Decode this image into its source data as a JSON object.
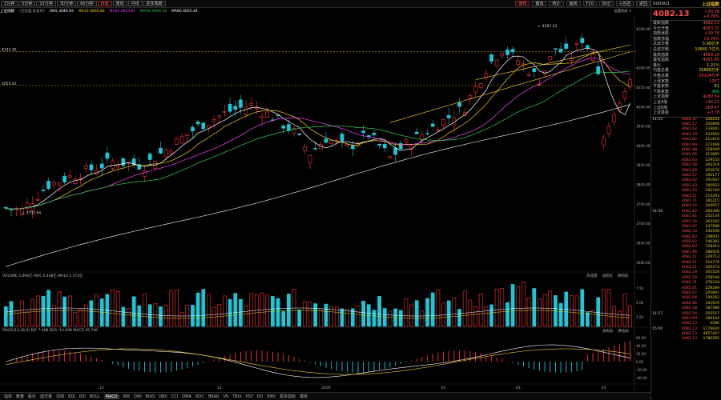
{
  "toolbar": {
    "timeframes": [
      "1分钟",
      "5分钟",
      "15分钟",
      "30分钟",
      "60分钟",
      "日线",
      "周线",
      "月线",
      "更多周期"
    ],
    "active_timeframe": "日线",
    "tools": [
      "复权",
      "叠加",
      "统计",
      "画线",
      "F10",
      "标记",
      "+自选",
      "返回"
    ]
  },
  "info_row": {
    "index_name": "上证指数",
    "adjust": "(已处理,前复权)",
    "mas": [
      {
        "text": "MA5 4046.93",
        "color": "#ffffff"
      },
      {
        "text": "MA10 4006.86",
        "color": "#f0d020"
      },
      {
        "text": "MA20 3953.67",
        "color": "#ff44ff"
      },
      {
        "text": "MA30 3993.34",
        "color": "#30d050"
      },
      {
        "text": "MA60 4055.44",
        "color": "#ffffff"
      }
    ],
    "right": "设置指标 ▾"
  },
  "price_axis": [
    "4200.00",
    "4100.00",
    "4050.00",
    "4000.00",
    "3950.00",
    "3900.00",
    "3850.00",
    "3800.00",
    "3750.00",
    "3700.00",
    "3650.00",
    "3600.00"
  ],
  "annotations": {
    "high": "4197.23",
    "low": "3732.94",
    "level1": "4142.35",
    "level2": "4055.42"
  },
  "volume": {
    "label": "VOLUME 5.896亿  MA5 5.448亿  MA10 5.573亿",
    "axis": [
      "7.50",
      "5.00",
      "2.50"
    ],
    "buttons": [
      "改成量",
      "加指标",
      "换指标"
    ]
  },
  "macd": {
    "label": "MACD(12,26,9)  DIF 7.408  DEA -14.608  MACD 45.746",
    "axis": [
      "60.00",
      "40.00",
      "20.00",
      "0.00",
      "-20.00",
      "-40.00"
    ],
    "buttons": [
      "加指标",
      "换指标"
    ]
  },
  "x_axis": [
    "11",
    "12",
    "2026",
    "02",
    "03",
    "04"
  ],
  "sidebar": {
    "code": "000001",
    "name": "上证指数",
    "price": "4082.13",
    "change": "+30.78",
    "change_pct": "+0.76%",
    "stats": [
      {
        "label": "最新指数",
        "value": "4082.13",
        "color": "#ff4d4d"
      },
      {
        "label": "今日开盘",
        "value": "4053.37",
        "color": "#ff4d4d"
      },
      {
        "label": "指数涨跌",
        "value": "+30.78",
        "color": "#ff4d4d"
      },
      {
        "label": "指数涨幅",
        "value": "+0.76%",
        "color": "#ff4d4d"
      },
      {
        "label": "总成交量",
        "value": "5.98亿手",
        "color": "#e8d21a"
      },
      {
        "label": "总成交额",
        "value": "10845.7亿元",
        "color": "#e8d21a"
      },
      {
        "label": "最高指数",
        "value": "4083.19",
        "color": "#ff4d4d"
      },
      {
        "label": "最低指数",
        "value": "4051.65",
        "color": "#ff4d4d"
      },
      {
        "label": "量比",
        "value": "1.21%",
        "color": "#e8d21a"
      },
      {
        "label": "内盘总量",
        "value": "29888万手",
        "color": "#e8d21a"
      },
      {
        "label": "外盘总量",
        "value": "29104万手",
        "color": "#ff4d4d"
      },
      {
        "label": "上涨家数",
        "value": "1357",
        "color": "#ff4d4d"
      },
      {
        "label": "平盘家数",
        "value": "81",
        "color": "#e8d21a"
      },
      {
        "label": "下跌家数",
        "value": "966",
        "color": "#00e060"
      },
      {
        "label": "上证指数",
        "value": "4280.54",
        "color": "#ff4d4d"
      },
      {
        "label": "上证A股",
        "value": "+32.21",
        "color": "#ff4d4d"
      },
      {
        "label": "上证B股",
        "value": "269.47",
        "color": "#ff4d4d"
      },
      {
        "label": "上证基金",
        "value": "+0.78",
        "color": "#ff4d4d"
      }
    ],
    "ticks": [
      {
        "t": "14:55",
        "p": "4081.47",
        "v": "328204",
        "c": "#ff4d4d"
      },
      {
        "t": "",
        "p": "4081.12",
        "v": "242808",
        "c": "#ff4d4d"
      },
      {
        "t": "",
        "p": "4081.62",
        "v": "233041",
        "c": "#ff4d4d"
      },
      {
        "t": "",
        "p": "4081.78",
        "v": "222959",
        "c": "#ff4d4d"
      },
      {
        "t": "",
        "p": "4081.62",
        "v": "211619",
        "c": "#ff4d4d"
      },
      {
        "t": "",
        "p": "4081.89",
        "v": "272168",
        "c": "#ff4d4d"
      },
      {
        "t": "",
        "p": "4081.88",
        "v": "218449",
        "c": "#ff4d4d"
      },
      {
        "t": "",
        "p": "4081.65",
        "v": "213695",
        "c": "#ff4d4d"
      },
      {
        "t": "",
        "p": "4081.63",
        "v": "229155",
        "c": "#ff4d4d"
      },
      {
        "t": "",
        "p": "4081.58",
        "v": "283319",
        "c": "#ff4d4d"
      },
      {
        "t": "",
        "p": "4081.69",
        "v": "203676",
        "c": "#ff4d4d"
      },
      {
        "t": "",
        "p": "4081.57",
        "v": "192177",
        "c": "#ff4d4d"
      },
      {
        "t": "",
        "p": "4081.62",
        "v": "191647",
        "c": "#ff4d4d"
      },
      {
        "t": "",
        "p": "4081.43",
        "v": "195922",
        "c": "#ff4d4d"
      },
      {
        "t": "",
        "p": "4081.55",
        "v": "192749",
        "c": "#ff4d4d"
      },
      {
        "t": "",
        "p": "4081.51",
        "v": "214293",
        "c": "#ff4d4d"
      },
      {
        "t": "",
        "p": "4081.71",
        "v": "185215",
        "c": "#ff4d4d"
      },
      {
        "t": "",
        "p": "4081.54",
        "v": "204057",
        "c": "#ff4d4d"
      },
      {
        "t": "14:56",
        "p": "4081.62",
        "v": "264349",
        "c": "#ff4d4d"
      },
      {
        "t": "",
        "p": "4081.81",
        "v": "252134",
        "c": "#ff4d4d"
      },
      {
        "t": "",
        "p": "4081.24",
        "v": "263435",
        "c": "#ff4d4d"
      },
      {
        "t": "",
        "p": "4081.97",
        "v": "247588",
        "c": "#ff4d4d"
      },
      {
        "t": "",
        "p": "4082.33",
        "v": "240198",
        "c": "#ff4d4d"
      },
      {
        "t": "",
        "p": "4082.83",
        "v": "248001",
        "c": "#ff4d4d"
      },
      {
        "t": "",
        "p": "4082.02",
        "v": "246381",
        "c": "#ff4d4d"
      },
      {
        "t": "",
        "p": "4082.00",
        "v": "228414",
        "c": "#ff4d4d"
      },
      {
        "t": "",
        "p": "4081.98",
        "v": "286926",
        "c": "#ff4d4d"
      },
      {
        "t": "",
        "p": "4082.11",
        "v": "229713",
        "c": "#ff4d4d"
      },
      {
        "t": "",
        "p": "4082.51",
        "v": "214776",
        "c": "#ff4d4d"
      },
      {
        "t": "",
        "p": "4082.21",
        "v": "305574",
        "c": "#ff4d4d"
      },
      {
        "t": "",
        "p": "4082.29",
        "v": "265528",
        "c": "#ff4d4d"
      },
      {
        "t": "",
        "p": "4082.29",
        "v": "258548",
        "c": "#ff4d4d"
      },
      {
        "t": "",
        "p": "4082.31",
        "v": "276334",
        "c": "#ff4d4d"
      },
      {
        "t": "",
        "p": "4082.81",
        "v": "228289",
        "c": "#ff4d4d"
      },
      {
        "t": "",
        "p": "4082.97",
        "v": "205891",
        "c": "#ff4d4d"
      },
      {
        "t": "",
        "p": "4082.84",
        "v": "199262",
        "c": "#ff4d4d"
      },
      {
        "t": "",
        "p": "4082.86",
        "v": "192929",
        "c": "#ff4d4d"
      },
      {
        "t": "",
        "p": "4082.58",
        "v": "187388",
        "c": "#ff4d4d"
      },
      {
        "t": "14:57",
        "p": "4082.54",
        "v": "203517",
        "c": "#ff4d4d"
      },
      {
        "t": "",
        "p": "4083.00",
        "v": "184164",
        "c": "#ff4d4d"
      },
      {
        "t": "",
        "p": "4082.13",
        "v": "4596",
        "c": "#ff4d4d"
      },
      {
        "t": "15:00",
        "p": "4082.13",
        "v": "1776830",
        "c": "#ff4d4d"
      },
      {
        "t": "",
        "p": "4082.13",
        "v": "4057447",
        "c": "#ff4d4d"
      },
      {
        "t": "",
        "p": "4082.13",
        "v": "1786295",
        "c": "#ff4d4d"
      }
    ]
  },
  "bottom_tabs": [
    "指标",
    "教量",
    "股价",
    "成交量",
    "均线",
    "KDJ",
    "RSI",
    "BOLL",
    "MACD",
    "WR",
    "DMI",
    "BIAS",
    "OBV",
    "CCI",
    "DMA",
    "ROC",
    "BRAR",
    "VR",
    "TRIX",
    "PSY",
    "KD",
    "EMV",
    "更多指标",
    "模板"
  ],
  "active_bottom_tab": "MACD"
}
